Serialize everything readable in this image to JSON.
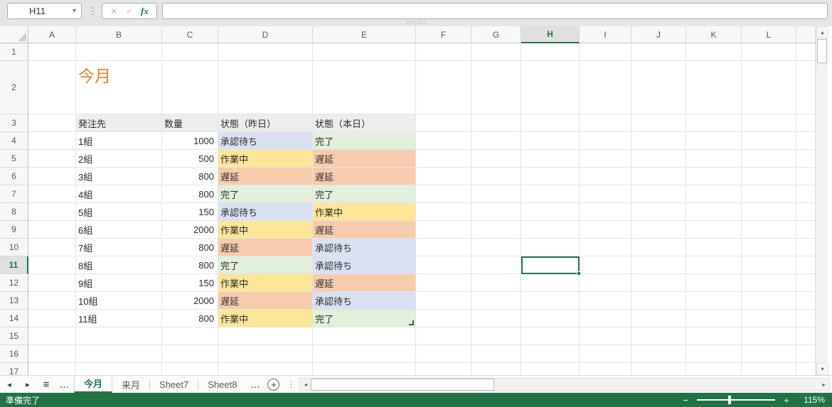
{
  "name_box": {
    "value": "H11"
  },
  "formula_bar": {
    "value": ""
  },
  "icons": {
    "name_box_arrow": "▾",
    "cancel": "✕",
    "enter": "✓",
    "fx": "fx",
    "grip_vertical": "⋮",
    "sheet_prev": "◂",
    "sheet_next": "▸",
    "sheet_list": "≡",
    "tab_overflow_left": "…",
    "tab_overflow_right": "…",
    "new_sheet": "+",
    "scroll_left": "◂",
    "scroll_right": "▸",
    "scroll_up": "▴",
    "scroll_down": "▾",
    "zoom_out": "−",
    "zoom_in": "+"
  },
  "sheet": {
    "columns": [
      "A",
      "B",
      "C",
      "D",
      "E",
      "F",
      "G",
      "H",
      "I",
      "J",
      "K",
      "L"
    ],
    "row_count": 17,
    "active_cell": "H11",
    "active_column": "H",
    "active_row": 11,
    "title_cell": {
      "ref": "B2",
      "text": "今月",
      "color": "#ED7D31"
    },
    "table": {
      "header_row": 3,
      "start_column": "B",
      "headers": [
        "発注先",
        "数量",
        "状態（昨日）",
        "状態（本日）"
      ],
      "header_fill": "#EDEDED",
      "status_fills": {
        "承認待ち": "#D9E1F2",
        "作業中": "#FFE699",
        "遅延": "#F8CBAD",
        "完了": "#E2EFDA"
      },
      "rows": [
        {
          "row": 4,
          "supplier": "1組",
          "quantity": "1000",
          "yesterday": "承認待ち",
          "today": "完了"
        },
        {
          "row": 5,
          "supplier": "2組",
          "quantity": "500",
          "yesterday": "作業中",
          "today": "遅延"
        },
        {
          "row": 6,
          "supplier": "3組",
          "quantity": "800",
          "yesterday": "遅延",
          "today": "遅延"
        },
        {
          "row": 7,
          "supplier": "4組",
          "quantity": "800",
          "yesterday": "完了",
          "today": "完了"
        },
        {
          "row": 8,
          "supplier": "5組",
          "quantity": "150",
          "yesterday": "承認待ち",
          "today": "作業中"
        },
        {
          "row": 9,
          "supplier": "6組",
          "quantity": "2000",
          "yesterday": "作業中",
          "today": "遅延"
        },
        {
          "row": 10,
          "supplier": "7組",
          "quantity": "800",
          "yesterday": "遅延",
          "today": "承認待ち"
        },
        {
          "row": 11,
          "supplier": "8組",
          "quantity": "800",
          "yesterday": "完了",
          "today": "承認待ち"
        },
        {
          "row": 12,
          "supplier": "9組",
          "quantity": "150",
          "yesterday": "作業中",
          "today": "遅延"
        },
        {
          "row": 13,
          "supplier": "10組",
          "quantity": "2000",
          "yesterday": "遅延",
          "today": "承認待ち"
        },
        {
          "row": 14,
          "supplier": "11組",
          "quantity": "800",
          "yesterday": "作業中",
          "today": "完了"
        }
      ]
    }
  },
  "tabs": {
    "items": [
      {
        "label": "今月",
        "active": true
      },
      {
        "label": "来月",
        "active": false
      },
      {
        "label": "Sheet7",
        "active": false
      },
      {
        "label": "Sheet8",
        "active": false
      }
    ]
  },
  "status_bar": {
    "ready": "準備完了",
    "zoom": "115%"
  },
  "colors": {
    "excel_green": "#217346"
  }
}
